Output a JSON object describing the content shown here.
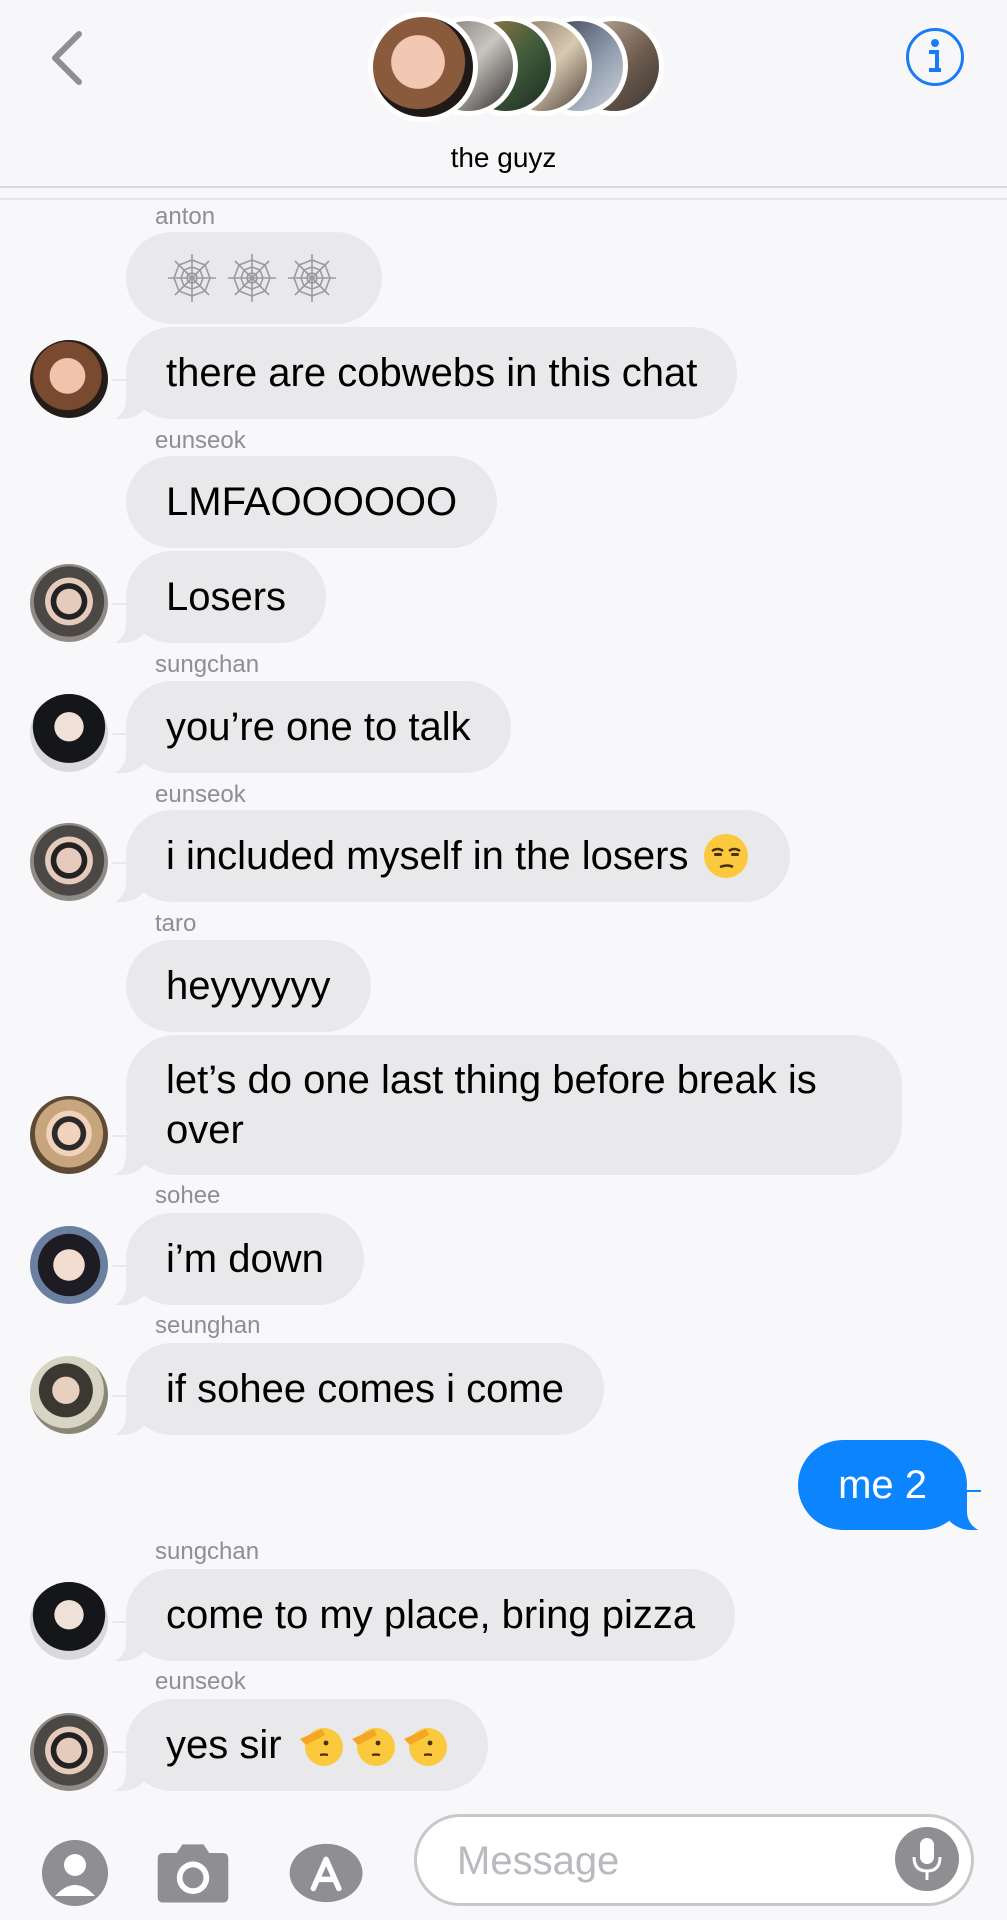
{
  "header": {
    "back_label": "",
    "title": "the guyz",
    "info_label": "i"
  },
  "messages": [
    {
      "sender": "anton",
      "text": "",
      "type": "cobweb-emojis"
    },
    {
      "sender": "",
      "text": "there are cobwebs in this chat"
    },
    {
      "sender": "eunseok",
      "text": "LMFAOOOOOO"
    },
    {
      "sender": "",
      "text": "Losers"
    },
    {
      "sender": "sungchan",
      "text": "you’re one to talk"
    },
    {
      "sender": "eunseok",
      "text": "i included myself in the losers"
    },
    {
      "sender": "taro",
      "text": "heyyyyyy"
    },
    {
      "sender": "",
      "text": "let’s do one last thing before break is over"
    },
    {
      "sender": "sohee",
      "text": "i’m down"
    },
    {
      "sender": "seunghan",
      "text": "if sohee comes i come"
    },
    {
      "sender": "me",
      "text": "me 2"
    },
    {
      "sender": "sungchan",
      "text": "come to my place, bring pizza"
    },
    {
      "sender": "eunseok",
      "text": "yes sir"
    }
  ],
  "compose": {
    "placeholder": "Message"
  },
  "colors": {
    "accent": "#0b84fe",
    "incoming_bubble": "#e9e9eb",
    "sender_label": "#8e8e93"
  },
  "icons": [
    "chevron-left-icon",
    "info-icon",
    "cobweb-icon",
    "unamused-face-icon",
    "saluting-face-icon",
    "contact-icon",
    "camera-icon",
    "app-store-icon",
    "microphone-icon"
  ]
}
